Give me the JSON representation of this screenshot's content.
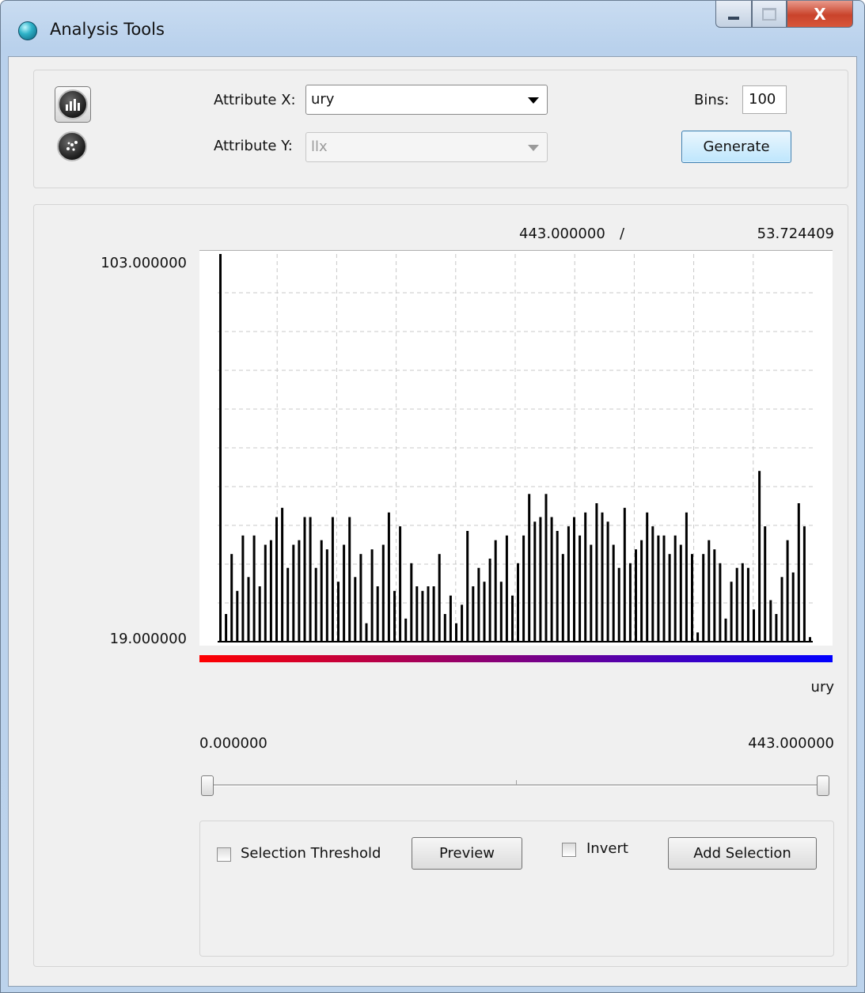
{
  "window": {
    "title": "Analysis Tools",
    "close_glyph": "X"
  },
  "controls": {
    "attr_x_label": "Attribute X:",
    "attr_x_value": "ury",
    "attr_y_label": "Attribute Y:",
    "attr_y_value": "llx",
    "bins_label": "Bins:",
    "bins_value": "100",
    "generate_label": "Generate"
  },
  "icons": {
    "histogram_mode": "histogram-icon",
    "scatter_mode": "scatter-icon",
    "app": "globe-icon"
  },
  "chart_header": {
    "cursor_x": "443.000000",
    "separator": "/",
    "cursor_y": "53.724409"
  },
  "chart_data": {
    "type": "bar",
    "title": "",
    "xlabel": "ury",
    "ylabel": "",
    "y_max_label": "103.000000",
    "y_min_label": "19.000000",
    "ylim": [
      19,
      103
    ],
    "xlim": [
      0,
      443
    ],
    "grid": true,
    "color_ramp": [
      "#ff0000",
      "#0000ff"
    ],
    "values": [
      103,
      25,
      38,
      30,
      42,
      33,
      42,
      31,
      40,
      41,
      46,
      48,
      35,
      40,
      41,
      46,
      46,
      35,
      41,
      39,
      46,
      32,
      40,
      46,
      33,
      38,
      23,
      39,
      31,
      40,
      47,
      30,
      44,
      24,
      36,
      31,
      30,
      31,
      31,
      38,
      25,
      29,
      23,
      27,
      43,
      31,
      35,
      32,
      37,
      41,
      32,
      42,
      29,
      36,
      42,
      51,
      45,
      46,
      51,
      46,
      43,
      38,
      44,
      46,
      42,
      47,
      40,
      49,
      47,
      45,
      40,
      35,
      48,
      36,
      39,
      41,
      47,
      44,
      42,
      42,
      38,
      42,
      40,
      47,
      38,
      21,
      38,
      41,
      39,
      36,
      24,
      32,
      35,
      36,
      35,
      26,
      56,
      44,
      28,
      25,
      33,
      41,
      34,
      49,
      44,
      20
    ]
  },
  "range": {
    "min": "0.000000",
    "max": "443.000000",
    "low_fraction": 0,
    "high_fraction": 1
  },
  "selection": {
    "threshold_label": "Selection Threshold",
    "threshold_checked": false,
    "preview_label": "Preview",
    "invert_label": "Invert",
    "invert_checked": false,
    "add_selection_label": "Add Selection"
  }
}
